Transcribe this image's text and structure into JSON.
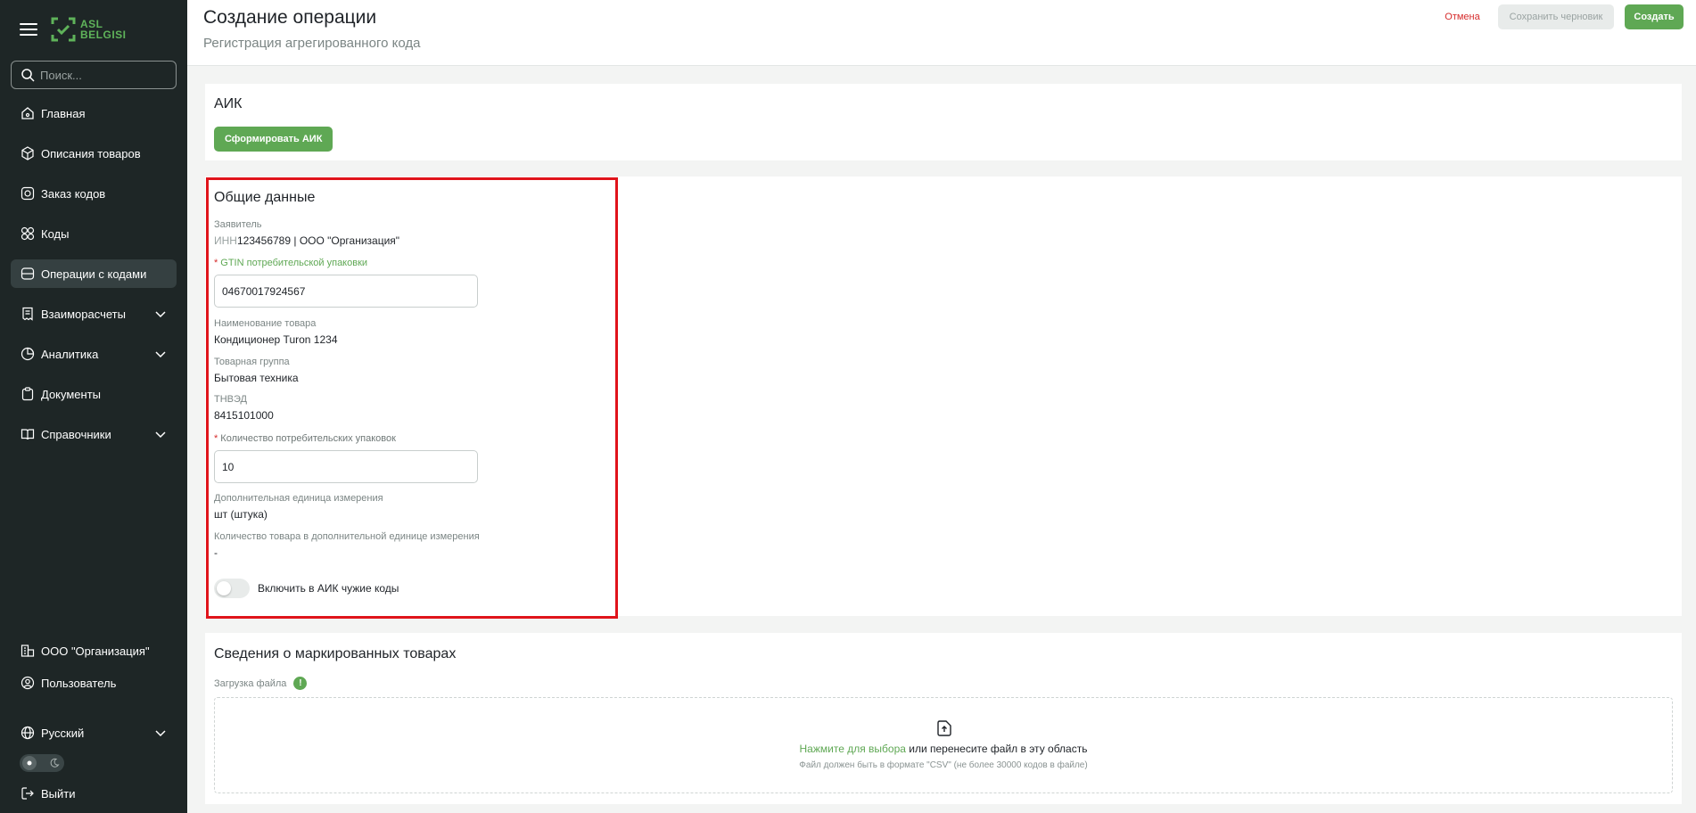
{
  "brand": {
    "logo_text_1": "ASL",
    "logo_text_2": "BELGISI"
  },
  "sidebar": {
    "search_placeholder": "Поиск...",
    "items": [
      {
        "label": "Главная",
        "icon": "home-icon",
        "active": false
      },
      {
        "label": "Описания товаров",
        "icon": "cube-icon",
        "active": false
      },
      {
        "label": "Заказ кодов",
        "icon": "code-order-icon",
        "active": false
      },
      {
        "label": "Коды",
        "icon": "codes-icon",
        "active": false
      },
      {
        "label": "Операции с кодами",
        "icon": "operations-icon",
        "active": true
      },
      {
        "label": "Взаиморасчеты",
        "icon": "receipt-icon",
        "active": false,
        "expandable": true
      },
      {
        "label": "Аналитика",
        "icon": "analytics-icon",
        "active": false,
        "expandable": true
      },
      {
        "label": "Документы",
        "icon": "clipboard-icon",
        "active": false
      },
      {
        "label": "Справочники",
        "icon": "book-icon",
        "active": false,
        "expandable": true
      }
    ],
    "organization": "ООО \"Организация\"",
    "user": "Пользователь",
    "language": "Русский",
    "logout": "Выйти"
  },
  "header": {
    "title": "Создание операции",
    "subtitle": "Регистрация агрегированного кода",
    "cancel_label": "Отмена",
    "draft_label": "Сохранить черновик",
    "create_label": "Создать"
  },
  "aik": {
    "title": "АИК",
    "generate_label": "Сформировать АИК"
  },
  "general": {
    "title": "Общие данные",
    "applicant_label": "Заявитель",
    "applicant_inn_prefix": "ИНН",
    "applicant_value": "123456789 | ООО \"Организация\"",
    "gtin_label": "GTIN потребительской упаковки",
    "gtin_value": "04670017924567",
    "product_name_label": "Наименование товара",
    "product_name_value": "Кондиционер Turon 1234",
    "product_group_label": "Товарная группа",
    "product_group_value": "Бытовая техника",
    "tnved_label": "ТНВЭД",
    "tnved_value": "8415101000",
    "qty_label": "Количество потребительских упаковок",
    "qty_value": "10",
    "extra_unit_label": "Дополнительная единица измерения",
    "extra_unit_value": "шт (штука)",
    "extra_qty_label": "Количество товара в дополнительной единице измерения",
    "extra_qty_value": "-",
    "foreign_codes_label": "Включить в АИК чужие коды",
    "foreign_codes_enabled": false
  },
  "marked": {
    "title": "Сведения о маркированных товарах",
    "upload_label": "Загрузка файла",
    "info_badge": "!",
    "dz_link": "Нажмите для выбора",
    "dz_text": " или перенесите файл в эту область",
    "dz_hint": "Файл должен быть в формате \"CSV\" (не более 30000 кодов в файле)"
  },
  "colors": {
    "sidebar_bg": "#1e2626",
    "accent_green": "#5fa854",
    "danger_red": "#d62c2c",
    "highlight_red": "#e0141b"
  }
}
